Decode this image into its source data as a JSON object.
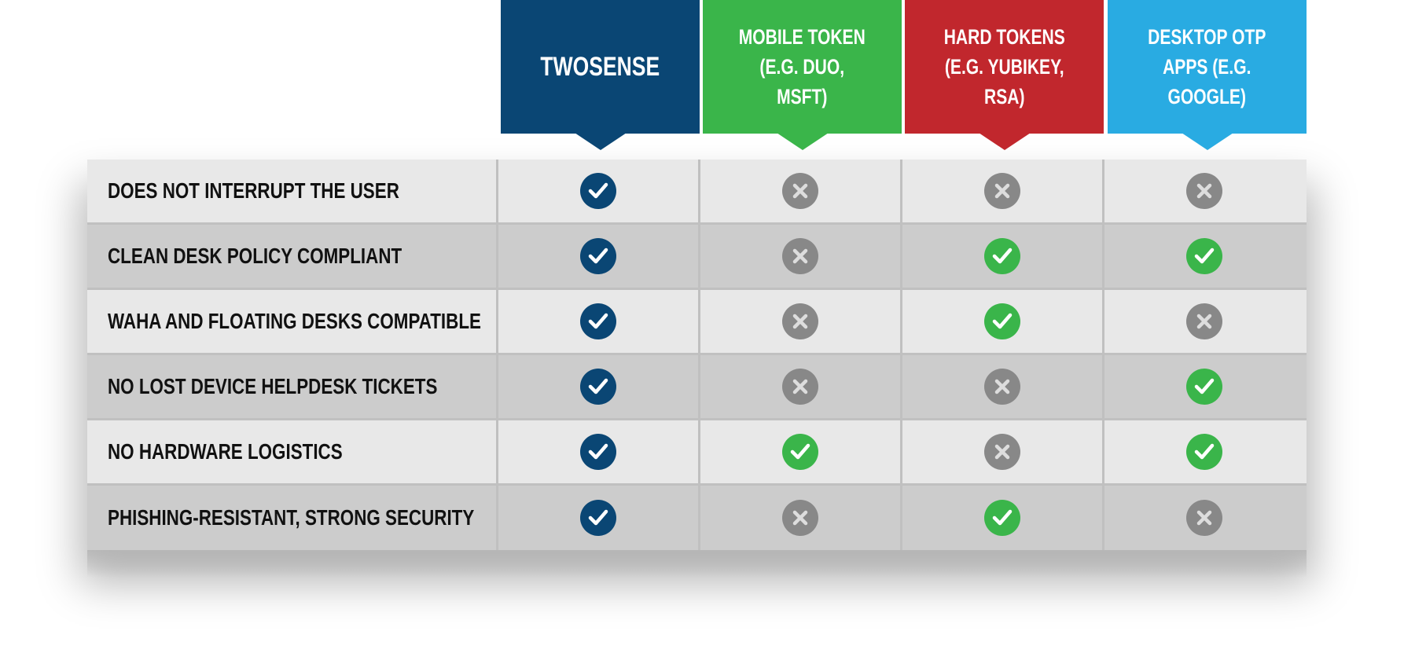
{
  "colors": {
    "twosense": "#0a4674",
    "mobile": "#3ab54a",
    "hard": "#c1272d",
    "desktop": "#29abe2",
    "check_green": "#3ab54a",
    "cross_gray": "#888888"
  },
  "columns": [
    {
      "key": "twosense",
      "label": "TWOSENSE",
      "color": "#0a4674"
    },
    {
      "key": "mobile",
      "label": "MOBILE TOKEN (E.G. DUO, MSFT)",
      "lines": [
        "MOBILE TOKEN",
        "(E.G. DUO,",
        "MSFT)"
      ],
      "color": "#3ab54a"
    },
    {
      "key": "hard",
      "label": "HARD TOKENS (E.G. YUBIKEY, RSA)",
      "lines": [
        "HARD TOKENS",
        "(E.G. YUBIKEY,",
        "RSA)"
      ],
      "color": "#c1272d"
    },
    {
      "key": "desktop",
      "label": "DESKTOP OTP APPS (E.G. GOOGLE)",
      "lines": [
        "DESKTOP OTP",
        "APPS (E.G.",
        "GOOGLE)"
      ],
      "color": "#29abe2"
    }
  ],
  "rows": [
    {
      "label": "DOES NOT INTERRUPT THE USER",
      "values": [
        true,
        false,
        false,
        false
      ]
    },
    {
      "label": "CLEAN DESK POLICY COMPLIANT",
      "values": [
        true,
        false,
        true,
        true
      ]
    },
    {
      "label": "WAHA AND FLOATING DESKS COMPATIBLE",
      "values": [
        true,
        false,
        true,
        false
      ]
    },
    {
      "label": "NO LOST DEVICE HELPDESK TICKETS",
      "values": [
        true,
        false,
        false,
        true
      ]
    },
    {
      "label": "NO HARDWARE LOGISTICS",
      "values": [
        true,
        true,
        false,
        true
      ]
    },
    {
      "label": "PHISHING-RESISTANT, STRONG SECURITY",
      "values": [
        true,
        false,
        true,
        false
      ]
    }
  ]
}
